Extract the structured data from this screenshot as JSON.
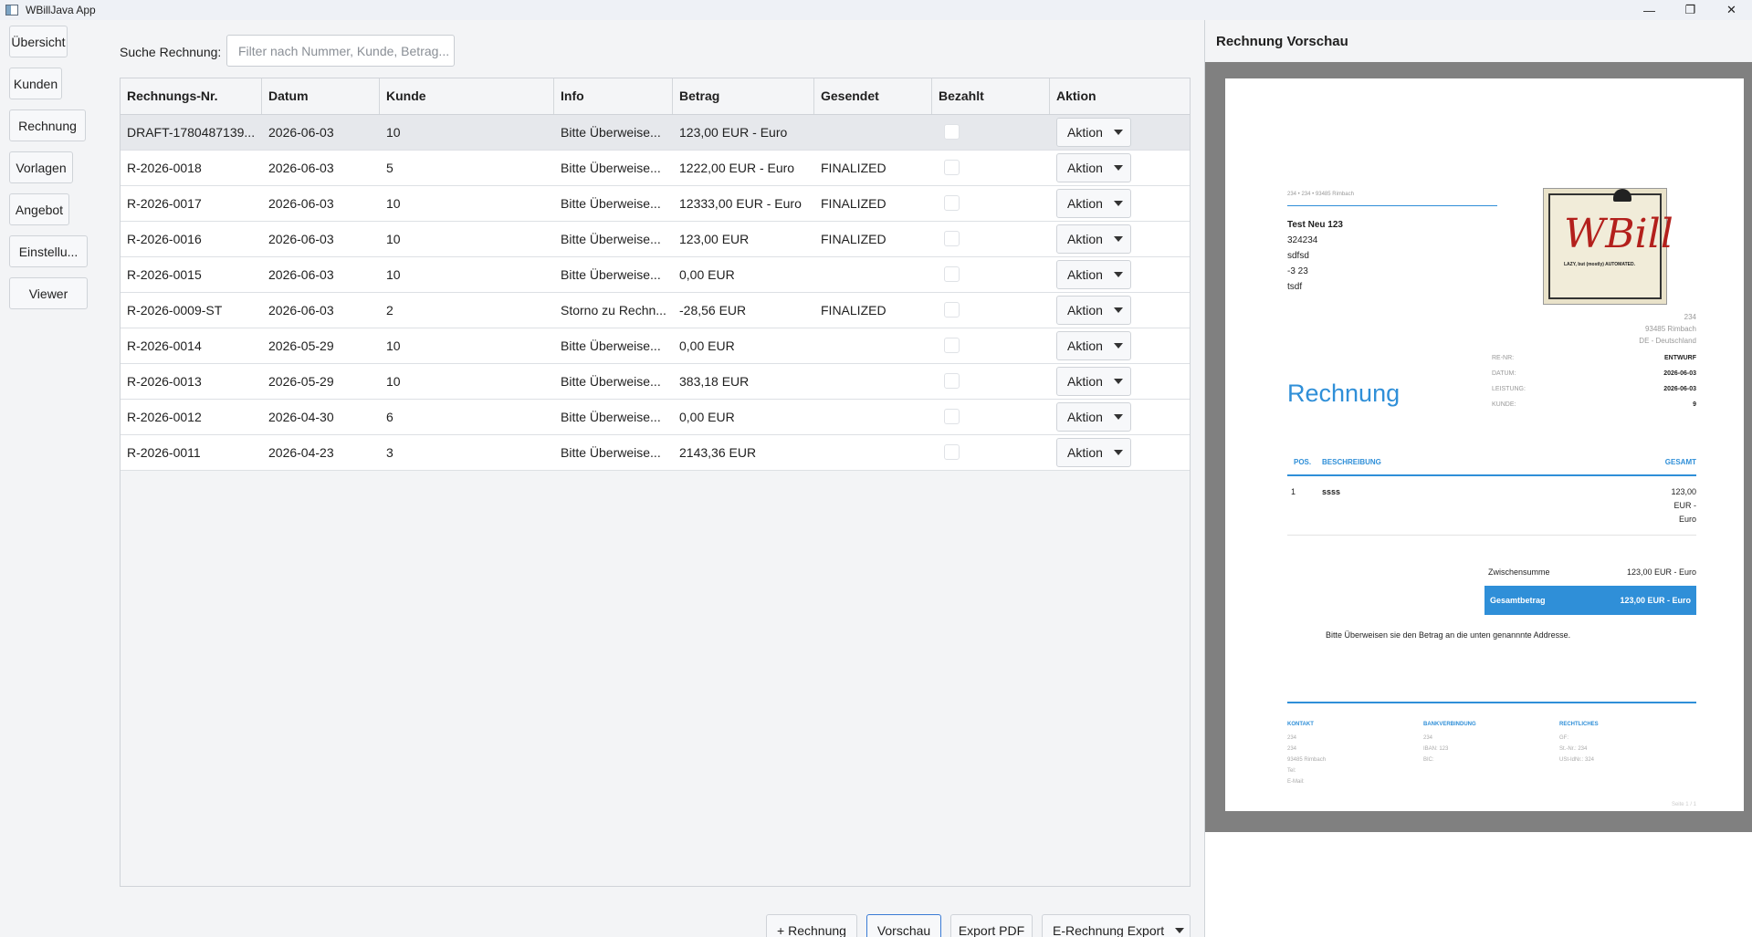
{
  "window": {
    "title": "WBillJava App",
    "minimize": "—",
    "maximize": "❐",
    "close": "✕"
  },
  "sidebar": {
    "items": [
      "Übersicht",
      "Kunden",
      "Rechnung",
      "Vorlagen",
      "Angebot",
      "Einstellu...",
      "Viewer"
    ]
  },
  "search": {
    "label": "Suche Rechnung:",
    "placeholder": "Filter nach Nummer, Kunde, Betrag..."
  },
  "table": {
    "columns": [
      "Rechnungs-Nr.",
      "Datum",
      "Kunde",
      "Info",
      "Betrag",
      "Gesendet",
      "Bezahlt",
      "Aktion"
    ],
    "rows": [
      {
        "nr": "DRAFT-1780487139...",
        "datum": "2026-06-03",
        "kunde": "10",
        "info": "Bitte Überweise...",
        "betrag": "123,00 EUR - Euro",
        "gesendet": "",
        "aktion": "Aktion"
      },
      {
        "nr": "R-2026-0018",
        "datum": "2026-06-03",
        "kunde": "5",
        "info": "Bitte Überweise...",
        "betrag": "1222,00 EUR - Euro",
        "gesendet": "FINALIZED",
        "aktion": "Aktion"
      },
      {
        "nr": "R-2026-0017",
        "datum": "2026-06-03",
        "kunde": "10",
        "info": "Bitte Überweise...",
        "betrag": "12333,00 EUR - Euro",
        "gesendet": "FINALIZED",
        "aktion": "Aktion"
      },
      {
        "nr": "R-2026-0016",
        "datum": "2026-06-03",
        "kunde": "10",
        "info": "Bitte Überweise...",
        "betrag": "123,00 EUR",
        "gesendet": "FINALIZED",
        "aktion": "Aktion"
      },
      {
        "nr": "R-2026-0015",
        "datum": "2026-06-03",
        "kunde": "10",
        "info": "Bitte Überweise...",
        "betrag": "0,00 EUR",
        "gesendet": "",
        "aktion": "Aktion"
      },
      {
        "nr": "R-2026-0009-ST",
        "datum": "2026-06-03",
        "kunde": "2",
        "info": "Storno zu Rechn...",
        "betrag": "-28,56 EUR",
        "gesendet": "FINALIZED",
        "aktion": "Aktion"
      },
      {
        "nr": "R-2026-0014",
        "datum": "2026-05-29",
        "kunde": "10",
        "info": "Bitte Überweise...",
        "betrag": "0,00 EUR",
        "gesendet": "",
        "aktion": "Aktion"
      },
      {
        "nr": "R-2026-0013",
        "datum": "2026-05-29",
        "kunde": "10",
        "info": "Bitte Überweise...",
        "betrag": "383,18 EUR",
        "gesendet": "",
        "aktion": "Aktion"
      },
      {
        "nr": "R-2026-0012",
        "datum": "2026-04-30",
        "kunde": "6",
        "info": "Bitte Überweise...",
        "betrag": "0,00 EUR",
        "gesendet": "",
        "aktion": "Aktion"
      },
      {
        "nr": "R-2026-0011",
        "datum": "2026-04-23",
        "kunde": "3",
        "info": "Bitte Überweise...",
        "betrag": "2143,36 EUR",
        "gesendet": "",
        "aktion": "Aktion"
      }
    ]
  },
  "buttons": {
    "new_invoice": "+ Rechnung",
    "preview": "Vorschau",
    "export_pdf": "Export PDF",
    "e_invoice_export": "E-Rechnung Export"
  },
  "preview": {
    "title": "Rechnung Vorschau",
    "sender_line": "234 • 234 • 93485 Rimbach",
    "recipient": [
      "Test Neu 123",
      "324234",
      "sdfsd",
      "-3 23",
      "tsdf"
    ],
    "logo_text": "WBill",
    "logo_tagline": "LAZY, but (mostly) AUTOMATED.",
    "sender_address": [
      "234",
      "93485 Rimbach",
      "DE - Deutschland"
    ],
    "meta": [
      {
        "label": "RE-NR:",
        "value": "ENTWURF"
      },
      {
        "label": "DATUM:",
        "value": "2026-06-03"
      },
      {
        "label": "LEISTUNG:",
        "value": "2026-06-03"
      },
      {
        "label": "KUNDE:",
        "value": "9"
      }
    ],
    "heading": "Rechnung",
    "items_header": {
      "pos": "POS.",
      "desc": "BESCHREIBUNG",
      "total": "GESAMT"
    },
    "item": {
      "pos": "1",
      "desc": "ssss",
      "total_lines": [
        "123,00",
        "EUR -",
        "Euro"
      ]
    },
    "subtotal_label": "Zwischensumme",
    "subtotal_value": "123,00 EUR - Euro",
    "total_label": "Gesamtbetrag",
    "total_value": "123,00 EUR - Euro",
    "note": "Bitte Überweisen sie den Betrag an die unten genannnte Addresse.",
    "footer": {
      "kontakt_title": "KONTAKT",
      "kontakt": [
        "234",
        "234",
        "93485 Rimbach",
        "Tel:",
        "E-Mail:"
      ],
      "bank_title": "BANKVERBINDUNG",
      "bank": [
        "234",
        "IBAN: 123",
        "BIC:"
      ],
      "recht_title": "RECHTLICHES",
      "recht": [
        "GF:",
        "St.-Nr.: 234",
        "USt-IdNr.: 324"
      ]
    },
    "page_num": "Seite 1 / 1"
  },
  "colors": {
    "accent": "#2f8fd8",
    "selection": "#e6e8ec",
    "preview_bg": "#808080"
  }
}
